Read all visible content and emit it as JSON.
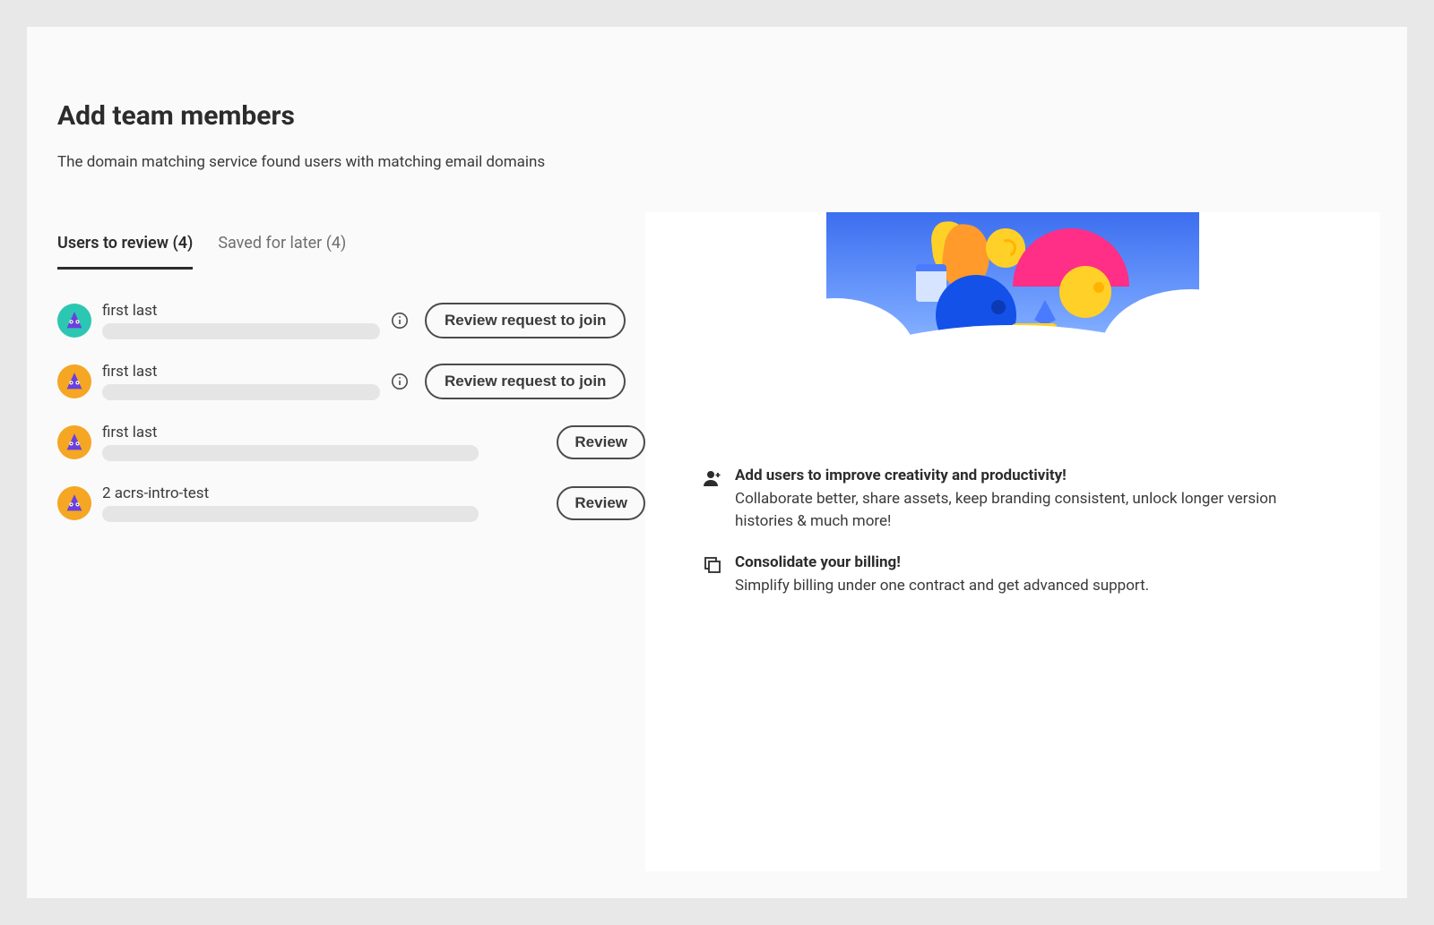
{
  "header": {
    "title": "Add team members",
    "subtitle": "The domain matching service found users with matching email domains"
  },
  "tabs": {
    "review_label": "Users to review (4)",
    "saved_label": "Saved for later (4)"
  },
  "users": [
    {
      "name": "first last",
      "avatar": "teal",
      "has_info": true,
      "button": "Review request to join",
      "wide": false
    },
    {
      "name": "first last",
      "avatar": "orange",
      "has_info": true,
      "button": "Review request to join",
      "wide": false
    },
    {
      "name": "first last",
      "avatar": "orange",
      "has_info": false,
      "button": "Review",
      "wide": true
    },
    {
      "name": "2 acrs-intro-test",
      "avatar": "orange",
      "has_info": false,
      "button": "Review",
      "wide": true
    }
  ],
  "benefits": [
    {
      "icon": "user-plus-icon",
      "title": "Add users to improve creativity and productivity!",
      "text": "Collaborate better, share assets, keep branding consistent, unlock longer version histories & much more!"
    },
    {
      "icon": "copy-icon",
      "title": "Consolidate your billing!",
      "text": "Simplify billing under one contract and get advanced support."
    }
  ]
}
